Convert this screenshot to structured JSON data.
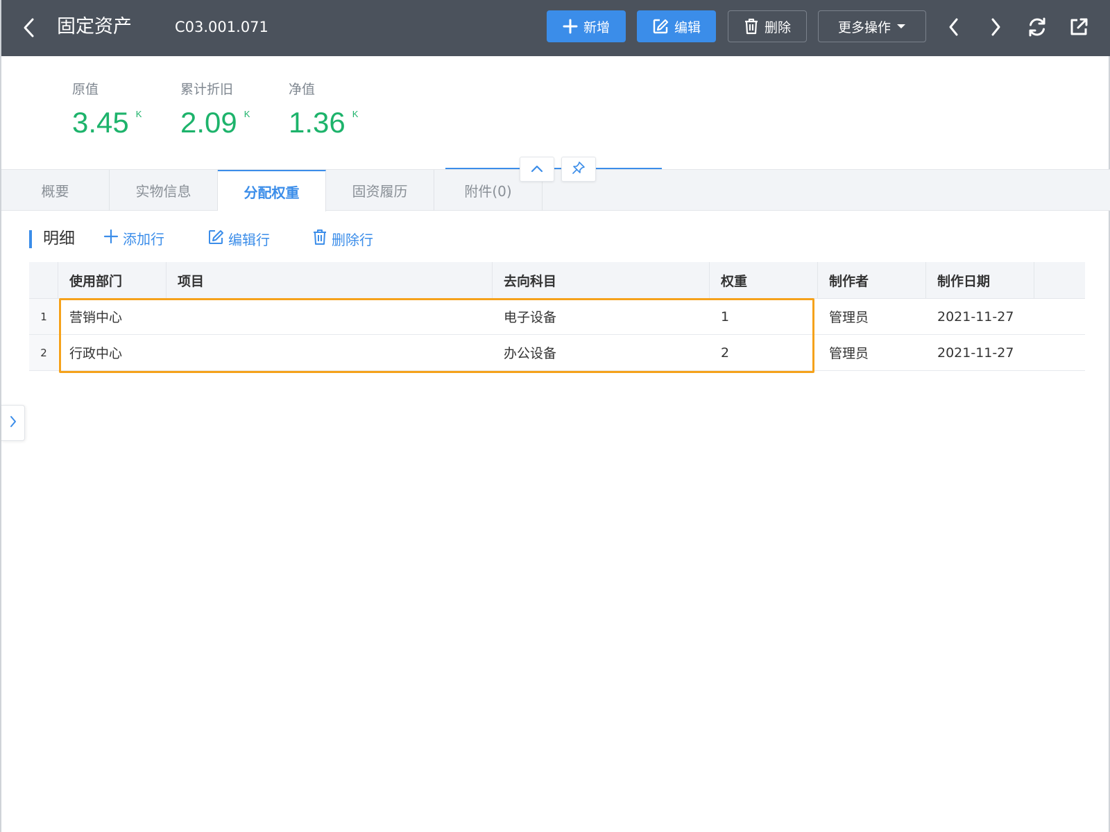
{
  "header": {
    "title": "固定资产",
    "code": "C03.001.071",
    "buttons": {
      "add": "新增",
      "edit": "编辑",
      "delete": "删除",
      "more": "更多操作"
    },
    "icons": [
      "back-icon",
      "prev-icon",
      "next-icon",
      "refresh-icon",
      "export-icon"
    ]
  },
  "stats": [
    {
      "label": "原值",
      "value": "3.45",
      "unit": "K"
    },
    {
      "label": "累计折旧",
      "value": "2.09",
      "unit": "K"
    },
    {
      "label": "净值",
      "value": "1.36",
      "unit": "K"
    }
  ],
  "tabs": [
    {
      "label": "概要",
      "active": false
    },
    {
      "label": "实物信息",
      "active": false
    },
    {
      "label": "分配权重",
      "active": true
    },
    {
      "label": "固资履历",
      "active": false
    },
    {
      "label": "附件(0)",
      "active": false
    }
  ],
  "detail": {
    "title": "明细",
    "add_row": "添加行",
    "edit_row": "编辑行",
    "delete_row": "删除行"
  },
  "table": {
    "columns": [
      "使用部门",
      "项目",
      "去向科目",
      "权重",
      "制作者",
      "制作日期"
    ],
    "rows": [
      {
        "no": "1",
        "cells": [
          "营销中心",
          "",
          "电子设备",
          "1",
          "管理员",
          "2021-11-27"
        ]
      },
      {
        "no": "2",
        "cells": [
          "行政中心",
          "",
          "办公设备",
          "2",
          "管理员",
          "2021-11-27"
        ]
      }
    ]
  },
  "colors": {
    "header_bg": "#4b525c",
    "primary": "#3b8de9",
    "stat_green": "#1db36b",
    "highlight": "#f5a21b"
  }
}
